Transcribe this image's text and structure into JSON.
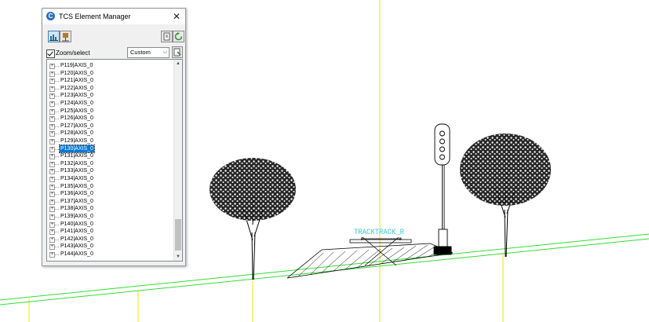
{
  "window": {
    "title": "TCS Element Manager",
    "app_icon": "C",
    "close_glyph": "✕"
  },
  "toolbar": {
    "tools": [
      {
        "name": "terrain-view-icon"
      },
      {
        "name": "signal-view-icon"
      },
      {
        "name": "export-icon"
      },
      {
        "name": "refresh-icon"
      }
    ]
  },
  "zoom_select": {
    "label": "Zoom/select",
    "checked": true
  },
  "filter": {
    "value": "Custom",
    "arrow": "⌵"
  },
  "tree": {
    "selected_index": 11,
    "items": [
      "P119|AXIS_0",
      "P120|AXIS_0",
      "P121|AXIS_0",
      "P122|AXIS_0",
      "P123|AXIS_0",
      "P124|AXIS_0",
      "P125|AXIS_0",
      "P126|AXIS_0",
      "P127|AXIS_0",
      "P128|AXIS_0",
      "P129|AXIS_0",
      "P130|AXIS_0",
      "P131|AXIS_0",
      "P132|AXIS_0",
      "P133|AXIS_0",
      "P134|AXIS_0",
      "P135|AXIS_0",
      "P136|AXIS_0",
      "P137|AXIS_0",
      "P138|AXIS_0",
      "P139|AXIS_0",
      "P140|AXIS_0",
      "P141|AXIS_0",
      "P142|AXIS_0",
      "P143|AXIS_0",
      "P144|AXIS_0"
    ],
    "expander_glyph": "+"
  },
  "cad": {
    "track_label": "TRACKTRACK_R",
    "colors": {
      "ground": "#33dd33",
      "axis": "#e8e800",
      "label": "#33cccc",
      "drawing": "#000000"
    }
  }
}
